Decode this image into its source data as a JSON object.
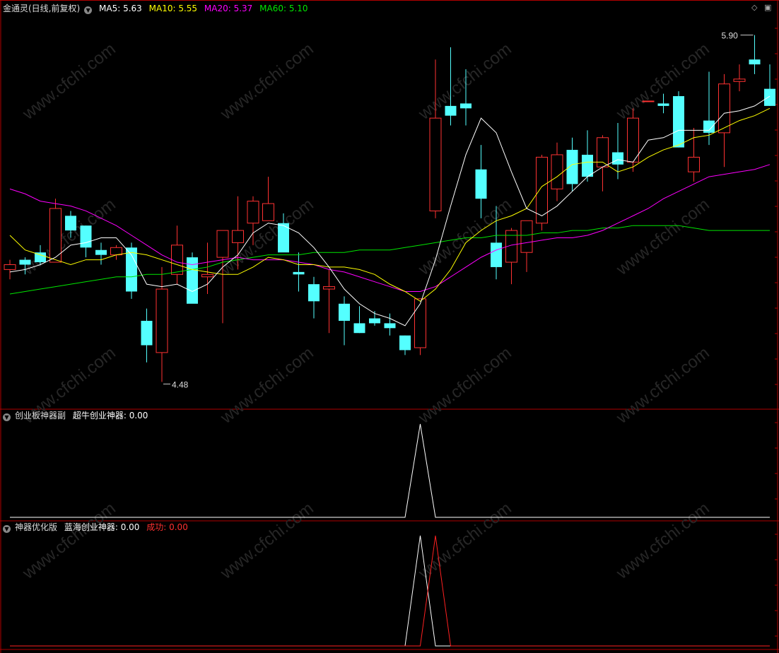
{
  "panel1": {
    "title": "金通灵(日线,前复权)",
    "ma5_label": "MA5: 5.63",
    "ma10_label": "MA10: 5.55",
    "ma20_label": "MA20: 5.37",
    "ma60_label": "MA60: 5.10",
    "high_marker": "5.90",
    "low_marker": "4.48"
  },
  "panel2": {
    "title": "创业板神器副",
    "series_label": "超牛创业神器: 0.00"
  },
  "panel3": {
    "title": "神器优化版",
    "series_label": "蓝海创业神器: 0.00",
    "success_label": "成功: 0.00"
  },
  "watermark": "www.cfchi.com",
  "corner_icons": [
    "diamond-icon",
    "restore-icon"
  ],
  "colors": {
    "up": "#ff3232",
    "down": "#54ffff",
    "ma5": "#ffffff",
    "ma10": "#ffff00",
    "ma20": "#ff00ff",
    "ma60": "#00e600",
    "frame": "#b00000"
  },
  "chart_data": {
    "type": "candlestick",
    "ylim": [
      4.4,
      5.98
    ],
    "candles": [
      {
        "o": 4.94,
        "h": 4.98,
        "l": 4.9,
        "c": 4.96
      },
      {
        "o": 4.98,
        "h": 4.99,
        "l": 4.92,
        "c": 4.96
      },
      {
        "o": 5.01,
        "h": 5.04,
        "l": 4.96,
        "c": 4.97
      },
      {
        "o": 4.97,
        "h": 5.23,
        "l": 4.97,
        "c": 5.19
      },
      {
        "o": 5.16,
        "h": 5.18,
        "l": 5.07,
        "c": 5.1
      },
      {
        "o": 5.12,
        "h": 5.12,
        "l": 4.99,
        "c": 5.03
      },
      {
        "o": 5.02,
        "h": 5.05,
        "l": 4.96,
        "c": 5.0
      },
      {
        "o": 5.0,
        "h": 5.04,
        "l": 4.98,
        "c": 5.03
      },
      {
        "o": 5.03,
        "h": 5.05,
        "l": 4.82,
        "c": 4.85
      },
      {
        "o": 4.73,
        "h": 4.78,
        "l": 4.56,
        "c": 4.63
      },
      {
        "o": 4.6,
        "h": 4.95,
        "l": 4.48,
        "c": 4.86
      },
      {
        "o": 4.92,
        "h": 5.12,
        "l": 4.88,
        "c": 5.04
      },
      {
        "o": 4.99,
        "h": 5.01,
        "l": 4.81,
        "c": 4.8
      },
      {
        "o": 4.91,
        "h": 5.05,
        "l": 4.84,
        "c": 4.92
      },
      {
        "o": 4.99,
        "h": 5.08,
        "l": 4.72,
        "c": 5.1
      },
      {
        "o": 5.05,
        "h": 5.24,
        "l": 4.94,
        "c": 5.1
      },
      {
        "o": 5.13,
        "h": 5.24,
        "l": 5.04,
        "c": 5.22
      },
      {
        "o": 5.14,
        "h": 5.32,
        "l": 5.14,
        "c": 5.21
      },
      {
        "o": 5.13,
        "h": 5.17,
        "l": 5.07,
        "c": 5.01
      },
      {
        "o": 4.93,
        "h": 5.01,
        "l": 4.85,
        "c": 4.92
      },
      {
        "o": 4.88,
        "h": 4.91,
        "l": 4.74,
        "c": 4.81
      },
      {
        "o": 4.86,
        "h": 4.94,
        "l": 4.68,
        "c": 4.87
      },
      {
        "o": 4.8,
        "h": 4.83,
        "l": 4.63,
        "c": 4.73
      },
      {
        "o": 4.72,
        "h": 4.79,
        "l": 4.68,
        "c": 4.68
      },
      {
        "o": 4.74,
        "h": 4.77,
        "l": 4.71,
        "c": 4.72
      },
      {
        "o": 4.72,
        "h": 4.76,
        "l": 4.67,
        "c": 4.7
      },
      {
        "o": 4.67,
        "h": 4.67,
        "l": 4.59,
        "c": 4.61
      },
      {
        "o": 4.62,
        "h": 4.82,
        "l": 4.59,
        "c": 4.82
      },
      {
        "o": 5.18,
        "h": 5.8,
        "l": 5.15,
        "c": 5.56
      },
      {
        "o": 5.61,
        "h": 5.85,
        "l": 5.53,
        "c": 5.57
      },
      {
        "o": 5.62,
        "h": 5.76,
        "l": 5.53,
        "c": 5.6
      },
      {
        "o": 5.35,
        "h": 5.45,
        "l": 5.15,
        "c": 5.23
      },
      {
        "o": 5.05,
        "h": 5.2,
        "l": 4.9,
        "c": 4.95
      },
      {
        "o": 4.97,
        "h": 5.11,
        "l": 4.88,
        "c": 5.1
      },
      {
        "o": 5.01,
        "h": 5.14,
        "l": 4.93,
        "c": 5.14
      },
      {
        "o": 5.13,
        "h": 5.41,
        "l": 5.1,
        "c": 5.4
      },
      {
        "o": 5.27,
        "h": 5.46,
        "l": 5.22,
        "c": 5.41
      },
      {
        "o": 5.43,
        "h": 5.48,
        "l": 5.26,
        "c": 5.29
      },
      {
        "o": 5.41,
        "h": 5.51,
        "l": 5.3,
        "c": 5.32
      },
      {
        "o": 5.36,
        "h": 5.49,
        "l": 5.26,
        "c": 5.48
      },
      {
        "o": 5.42,
        "h": 5.54,
        "l": 5.31,
        "c": 5.37
      },
      {
        "o": 5.38,
        "h": 5.6,
        "l": 5.34,
        "c": 5.56
      },
      {
        "o": 5.63,
        "h": 5.63,
        "l": 5.63,
        "c": 5.63
      },
      {
        "o": 5.62,
        "h": 5.66,
        "l": 5.58,
        "c": 5.61
      },
      {
        "o": 5.65,
        "h": 5.67,
        "l": 5.44,
        "c": 5.44
      },
      {
        "o": 5.34,
        "h": 5.52,
        "l": 5.3,
        "c": 5.4
      },
      {
        "o": 5.55,
        "h": 5.75,
        "l": 5.45,
        "c": 5.5
      },
      {
        "o": 5.5,
        "h": 5.74,
        "l": 5.36,
        "c": 5.7
      },
      {
        "o": 5.71,
        "h": 5.78,
        "l": 5.67,
        "c": 5.72
      },
      {
        "o": 5.8,
        "h": 5.9,
        "l": 5.74,
        "c": 5.78
      },
      {
        "o": 5.68,
        "h": 5.78,
        "l": 5.61,
        "c": 5.61
      }
    ],
    "ma5": [
      4.93,
      4.94,
      4.96,
      4.99,
      5.04,
      5.05,
      5.07,
      5.07,
      5.0,
      4.88,
      4.87,
      4.88,
      4.85,
      4.88,
      4.95,
      5.0,
      5.09,
      5.13,
      5.12,
      5.09,
      5.03,
      4.95,
      4.86,
      4.8,
      4.76,
      4.74,
      4.71,
      4.8,
      4.98,
      5.2,
      5.41,
      5.56,
      5.5,
      5.34,
      5.19,
      5.16,
      5.2,
      5.26,
      5.32,
      5.36,
      5.39,
      5.38,
      5.47,
      5.48,
      5.51,
      5.51,
      5.51,
      5.58,
      5.59,
      5.61,
      5.65
    ],
    "ma10": [
      5.08,
      5.02,
      5.0,
      4.98,
      4.96,
      4.98,
      4.98,
      5.0,
      5.01,
      5.0,
      4.98,
      4.96,
      4.94,
      4.93,
      4.92,
      4.92,
      4.95,
      4.99,
      4.98,
      4.96,
      4.96,
      4.95,
      4.95,
      4.94,
      4.92,
      4.88,
      4.85,
      4.81,
      4.86,
      4.94,
      5.05,
      5.1,
      5.14,
      5.16,
      5.19,
      5.28,
      5.32,
      5.37,
      5.38,
      5.38,
      5.34,
      5.36,
      5.4,
      5.43,
      5.45,
      5.48,
      5.49,
      5.52,
      5.55,
      5.57,
      5.6
    ],
    "ma20": [
      5.27,
      5.25,
      5.22,
      5.21,
      5.2,
      5.18,
      5.15,
      5.12,
      5.08,
      5.04,
      5.0,
      4.97,
      4.96,
      4.97,
      4.98,
      4.99,
      4.98,
      4.98,
      4.98,
      4.97,
      4.96,
      4.94,
      4.93,
      4.91,
      4.89,
      4.87,
      4.85,
      4.85,
      4.87,
      4.91,
      4.95,
      4.99,
      5.02,
      5.04,
      5.05,
      5.06,
      5.07,
      5.07,
      5.08,
      5.1,
      5.13,
      5.16,
      5.19,
      5.23,
      5.26,
      5.29,
      5.32,
      5.33,
      5.34,
      5.35,
      5.37
    ],
    "ma60": [
      4.84,
      4.85,
      4.86,
      4.87,
      4.88,
      4.89,
      4.9,
      4.91,
      4.91,
      4.92,
      4.92,
      4.93,
      4.94,
      4.95,
      4.97,
      4.98,
      4.99,
      5.0,
      5.0,
      5.0,
      5.01,
      5.01,
      5.01,
      5.02,
      5.02,
      5.02,
      5.03,
      5.04,
      5.05,
      5.06,
      5.07,
      5.07,
      5.08,
      5.08,
      5.08,
      5.09,
      5.09,
      5.1,
      5.1,
      5.11,
      5.11,
      5.12,
      5.12,
      5.12,
      5.12,
      5.11,
      5.1,
      5.1,
      5.1,
      5.1,
      5.1
    ],
    "panel2": {
      "ylim": [
        0,
        1.0
      ],
      "series": [
        {
          "name": "超牛创业神器",
          "values": [
            0,
            0,
            0,
            0,
            0,
            0,
            0,
            0,
            0,
            0,
            0,
            0,
            0,
            0,
            0,
            0,
            0,
            0,
            0,
            0,
            0,
            0,
            0,
            0,
            0,
            0,
            0,
            1,
            0,
            0,
            0,
            0,
            0,
            0,
            0,
            0,
            0,
            0,
            0,
            0,
            0,
            0,
            0,
            0,
            0,
            0,
            0,
            0,
            0,
            0,
            0
          ]
        }
      ]
    },
    "panel3": {
      "ylim": [
        0,
        1.0
      ],
      "series": [
        {
          "name": "蓝海创业神器",
          "values": [
            0,
            0,
            0,
            0,
            0,
            0,
            0,
            0,
            0,
            0,
            0,
            0,
            0,
            0,
            0,
            0,
            0,
            0,
            0,
            0,
            0,
            0,
            0,
            0,
            0,
            0,
            0,
            1,
            0,
            0,
            0,
            0,
            0,
            0,
            0,
            0,
            0,
            0,
            0,
            0,
            0,
            0,
            0,
            0,
            0,
            0,
            0,
            0,
            0,
            0,
            0
          ]
        },
        {
          "name": "成功",
          "values": [
            0,
            0,
            0,
            0,
            0,
            0,
            0,
            0,
            0,
            0,
            0,
            0,
            0,
            0,
            0,
            0,
            0,
            0,
            0,
            0,
            0,
            0,
            0,
            0,
            0,
            0,
            0,
            0,
            1,
            0,
            0,
            0,
            0,
            0,
            0,
            0,
            0,
            0,
            0,
            0,
            0,
            0,
            0,
            0,
            0,
            0,
            0,
            0,
            0,
            0,
            0
          ]
        }
      ]
    }
  }
}
